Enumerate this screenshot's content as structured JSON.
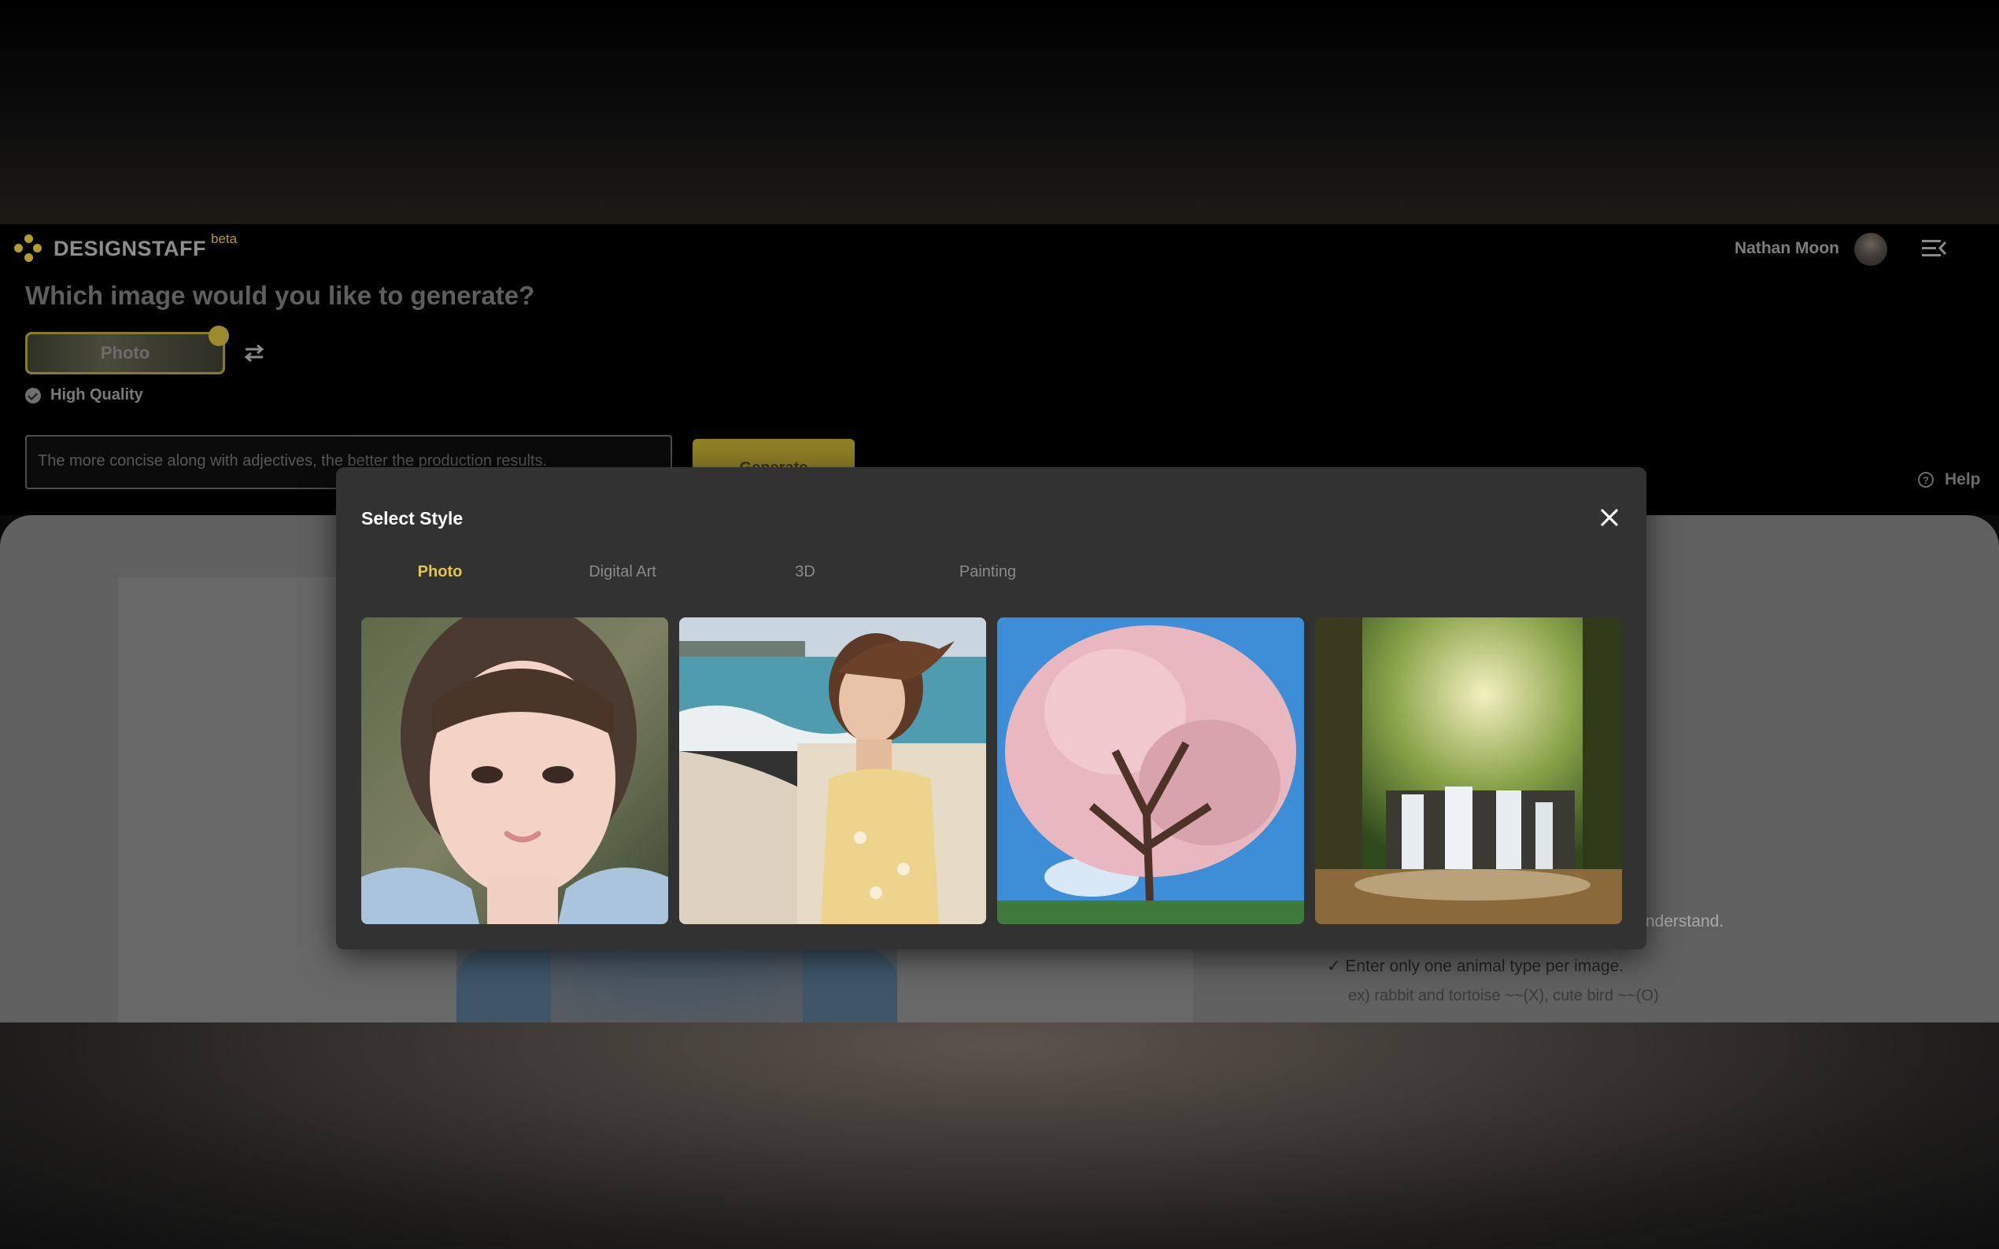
{
  "header": {
    "brand": "DESIGNSTAFF",
    "brand_badge": "beta",
    "user_name": "Nathan Moon",
    "help_label": "Help"
  },
  "generator": {
    "question": "Which image would you like to generate?",
    "selected_style": "Photo",
    "quality_label": "High Quality",
    "prompt_placeholder": "The more concise along with adjectives, the better the production results.",
    "generate_label": "Generate"
  },
  "guide": {
    "tip_tail": "an understand.",
    "tip_animal": "✓ Enter only one animal type per image.",
    "tip_example": "ex) rabbit and tortoise ~~(X), cute bird ~~(O)"
  },
  "modal": {
    "title": "Select Style",
    "tabs": [
      {
        "label": "Photo",
        "active": true
      },
      {
        "label": "Digital Art",
        "active": false
      },
      {
        "label": "3D",
        "active": false
      },
      {
        "label": "Painting",
        "active": false
      }
    ],
    "cards": [
      {
        "subject": "portrait-girl"
      },
      {
        "subject": "beach-woman"
      },
      {
        "subject": "cherry-blossom"
      },
      {
        "subject": "forest-waterfall"
      }
    ]
  },
  "colors": {
    "accent": "#e3c646",
    "modal_bg": "#323232",
    "page_bg": "#000000"
  },
  "icons": [
    "logo-icon",
    "menu-icon",
    "swap-icon",
    "check-icon",
    "help-icon",
    "close-icon"
  ]
}
